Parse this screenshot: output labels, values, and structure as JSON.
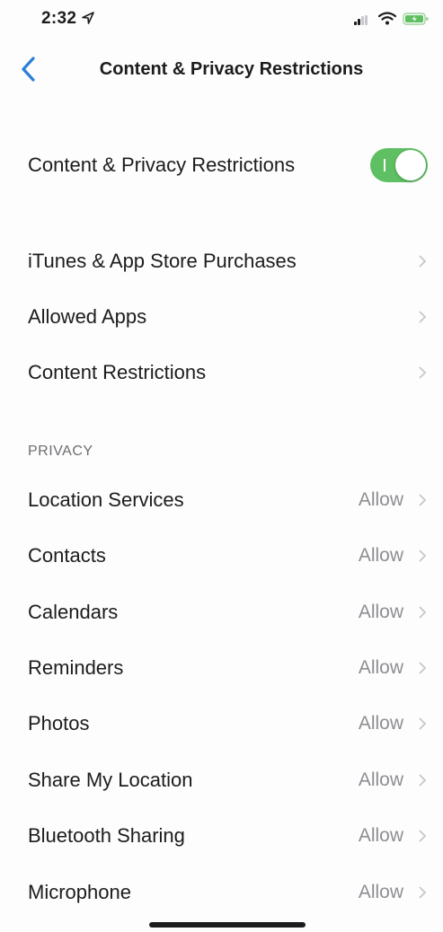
{
  "status_bar": {
    "time": "2:32",
    "icons": [
      "location-arrow-icon",
      "cellular-signal-icon",
      "wifi-icon",
      "battery-charging-icon"
    ]
  },
  "nav": {
    "back_icon": "chevron-left-icon",
    "title": "Content & Privacy Restrictions"
  },
  "master_toggle": {
    "label": "Content & Privacy Restrictions",
    "state": "on"
  },
  "store_section": {
    "items": [
      {
        "label": "iTunes & App Store Purchases"
      },
      {
        "label": "Allowed Apps"
      },
      {
        "label": "Content Restrictions"
      }
    ]
  },
  "privacy_section": {
    "header": "PRIVACY",
    "items": [
      {
        "label": "Location Services",
        "value": "Allow"
      },
      {
        "label": "Contacts",
        "value": "Allow"
      },
      {
        "label": "Calendars",
        "value": "Allow"
      },
      {
        "label": "Reminders",
        "value": "Allow"
      },
      {
        "label": "Photos",
        "value": "Allow"
      },
      {
        "label": "Share My Location",
        "value": "Allow"
      },
      {
        "label": "Bluetooth Sharing",
        "value": "Allow"
      },
      {
        "label": "Microphone",
        "value": "Allow"
      }
    ]
  },
  "colors": {
    "accent": "#2b7fd6",
    "toggle_on": "#5fbf63",
    "secondary_text": "#8e8e93"
  }
}
